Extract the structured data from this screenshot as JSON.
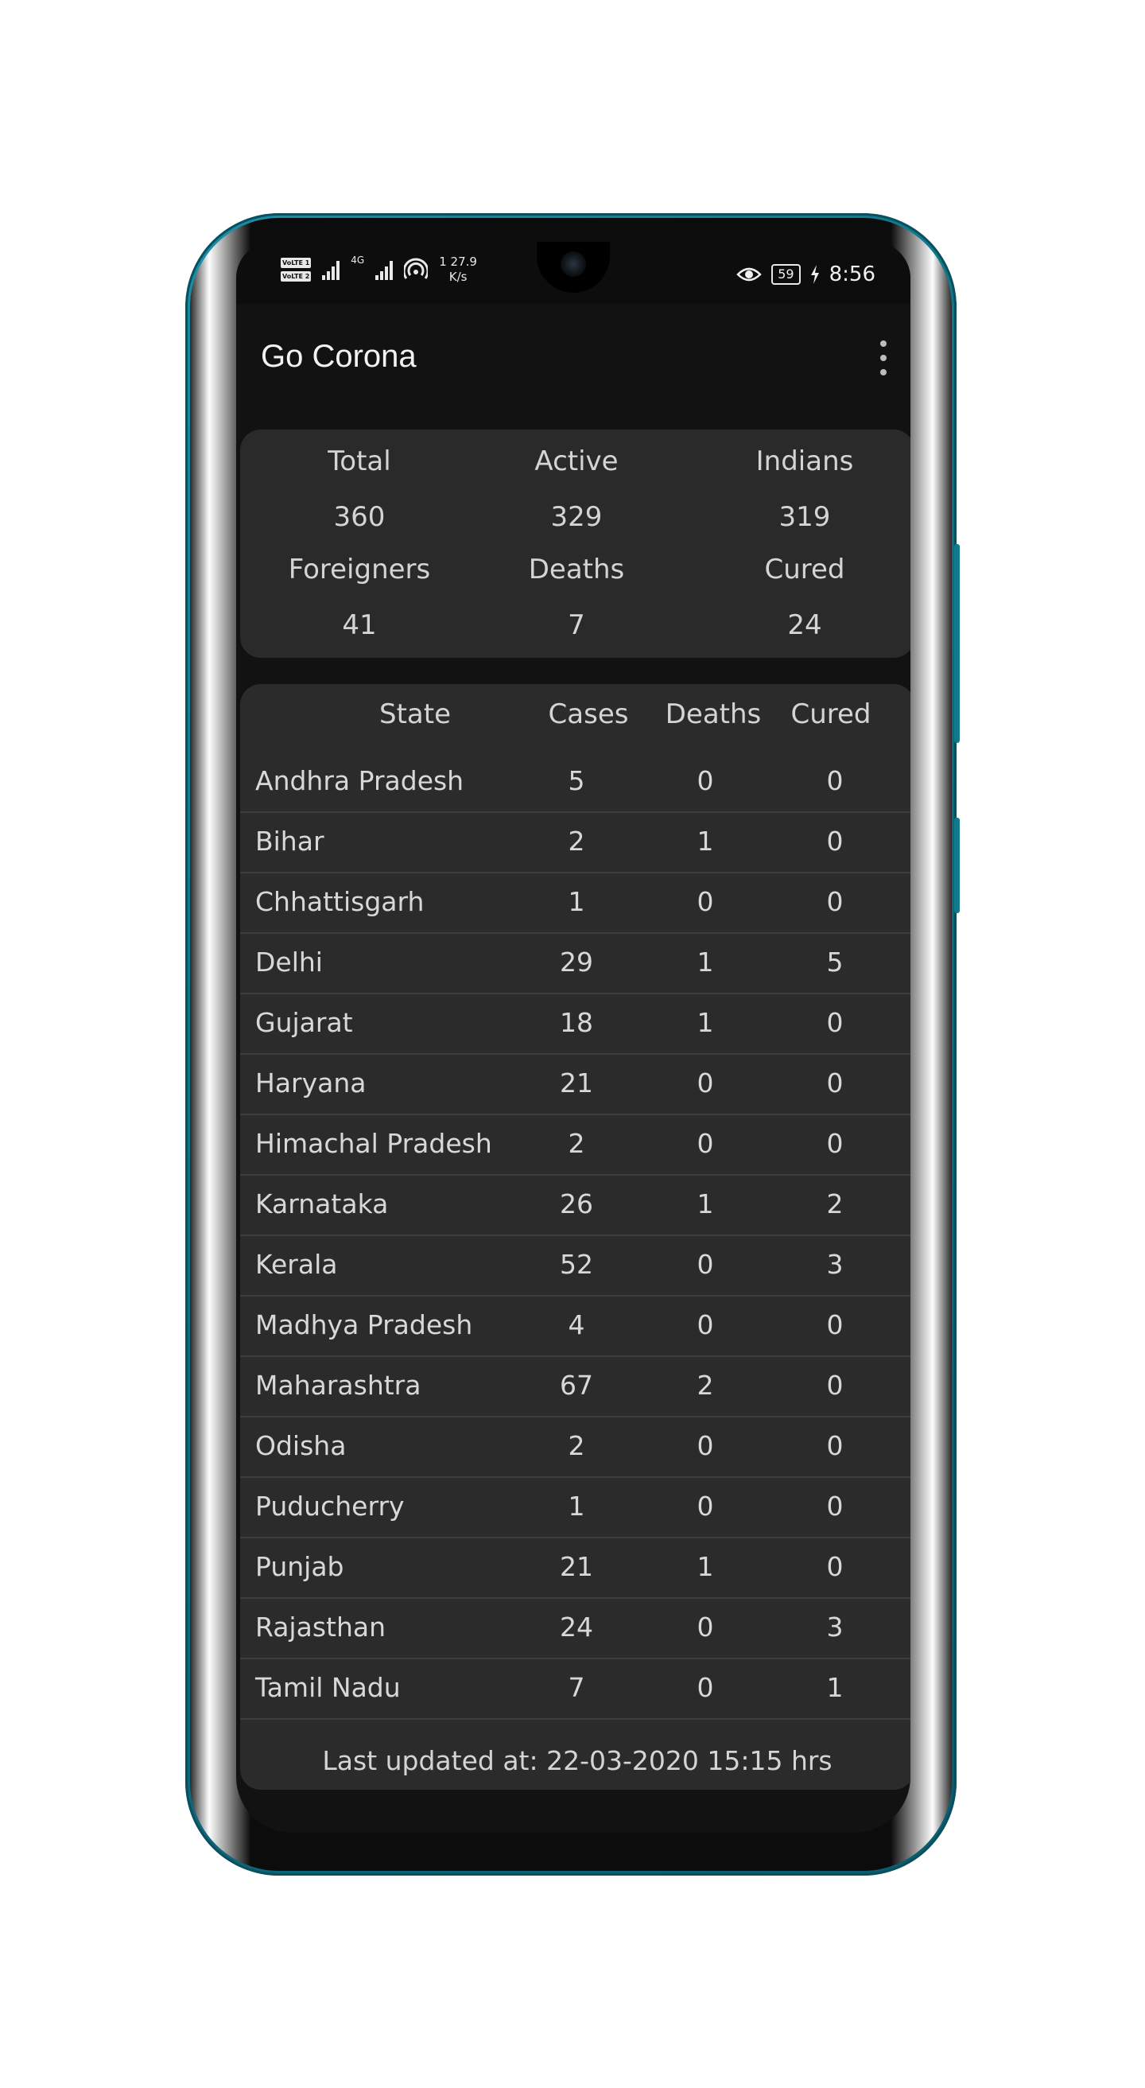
{
  "status_bar": {
    "volte1": "VoLTE 1",
    "volte2": "VoLTE 2",
    "network_type": "4G",
    "speed_value": "1 27.9",
    "speed_unit": "K/s",
    "battery": "59",
    "time": "8:56",
    "icons": [
      "signal-icon",
      "wifi-hotspot-icon",
      "eye-comfort-icon",
      "battery-icon",
      "charging-icon"
    ]
  },
  "app": {
    "title": "Go Corona",
    "menu_icon": "more-vert-icon"
  },
  "summary": {
    "total_label": "Total",
    "total_value": "360",
    "active_label": "Active",
    "active_value": "329",
    "indians_label": "Indians",
    "indians_value": "319",
    "foreigners_label": "Foreigners",
    "foreigners_value": "41",
    "deaths_label": "Deaths",
    "deaths_value": "7",
    "cured_label": "Cured",
    "cured_value": "24"
  },
  "table": {
    "headers": [
      "State",
      "Cases",
      "Deaths",
      "Cured"
    ],
    "rows": [
      [
        "Andhra Pradesh",
        "5",
        "0",
        "0"
      ],
      [
        "Bihar",
        "2",
        "1",
        "0"
      ],
      [
        "Chhattisgarh",
        "1",
        "0",
        "0"
      ],
      [
        "Delhi",
        "29",
        "1",
        "5"
      ],
      [
        "Gujarat",
        "18",
        "1",
        "0"
      ],
      [
        "Haryana",
        "21",
        "0",
        "0"
      ],
      [
        "Himachal Pradesh",
        "2",
        "0",
        "0"
      ],
      [
        "Karnataka",
        "26",
        "1",
        "2"
      ],
      [
        "Kerala",
        "52",
        "0",
        "3"
      ],
      [
        "Madhya Pradesh",
        "4",
        "0",
        "0"
      ],
      [
        "Maharashtra",
        "67",
        "2",
        "0"
      ],
      [
        "Odisha",
        "2",
        "0",
        "0"
      ],
      [
        "Puducherry",
        "1",
        "0",
        "0"
      ],
      [
        "Punjab",
        "21",
        "1",
        "0"
      ],
      [
        "Rajasthan",
        "24",
        "0",
        "3"
      ],
      [
        "Tamil Nadu",
        "7",
        "0",
        "1"
      ]
    ]
  },
  "footer": {
    "last_updated": "Last updated at: 22-03-2020  15:15 hrs"
  },
  "colors": {
    "phone_frame": "#137f93",
    "screen_bg": "#121212",
    "card_bg": "#2a2a2a",
    "divider": "#3d3d3d",
    "text": "#d6d6d6"
  }
}
